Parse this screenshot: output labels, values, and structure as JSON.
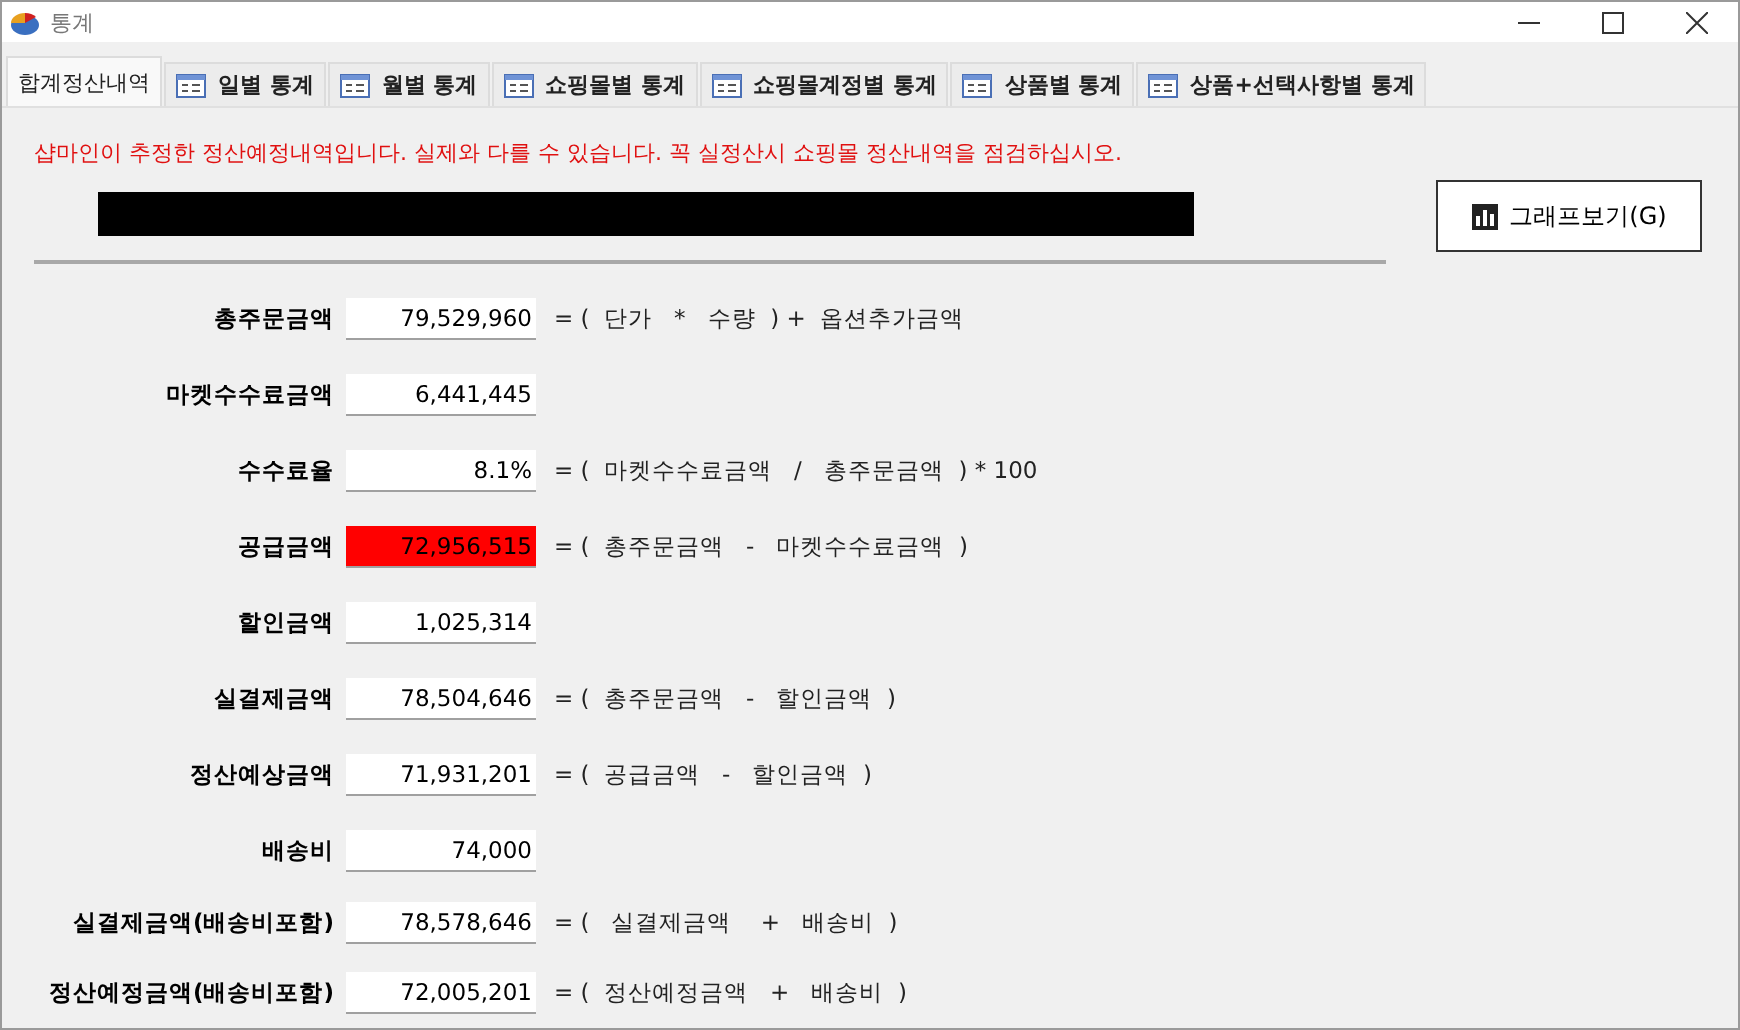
{
  "window": {
    "title": "통계"
  },
  "tabs": [
    {
      "label": "합계정산내역",
      "selected": true,
      "icon": false
    },
    {
      "label": "일별 통계",
      "selected": false,
      "icon": true
    },
    {
      "label": "월별 통계",
      "selected": false,
      "icon": true
    },
    {
      "label": "쇼핑몰별 통계",
      "selected": false,
      "icon": true
    },
    {
      "label": "쇼핑몰계정별 통계",
      "selected": false,
      "icon": true
    },
    {
      "label": "상품별 통계",
      "selected": false,
      "icon": true
    },
    {
      "label": "상품+선택사항별 통계",
      "selected": false,
      "icon": true
    }
  ],
  "notice": "샵마인이 추정한 정산예정내역입니다. 실제와 다를 수 있습니다. 꼭 실정산시 쇼핑몰 정산내역을 점검하십시오.",
  "graph_button": {
    "label": "그래프보기(G)"
  },
  "rows": [
    {
      "label": "총주문금액",
      "value": "79,529,960",
      "highlighted": false,
      "formula": "= (  단가   *   수량  ) +  옵션추가금액"
    },
    {
      "label": "마켓수수료금액",
      "value": "6,441,445",
      "highlighted": false
    },
    {
      "label": "수수료율",
      "value": "8.1%",
      "highlighted": false,
      "formula": "= (  마켓수수료금액   /   총주문금액  ) * 100"
    },
    {
      "label": "공급금액",
      "value": "72,956,515",
      "highlighted": true,
      "formula": "= (  총주문금액   -   마켓수수료금액  )"
    },
    {
      "label": "할인금액",
      "value": "1,025,314",
      "highlighted": false
    },
    {
      "label": "실결제금액",
      "value": "78,504,646",
      "highlighted": false,
      "formula": "= (  총주문금액   -   할인금액  )"
    },
    {
      "label": "정산예상금액",
      "value": "71,931,201",
      "highlighted": false,
      "formula": "= (  공급금액   -   할인금액  )"
    },
    {
      "label": "배송비",
      "value": "74,000",
      "highlighted": false
    },
    {
      "label": "실결제금액(배송비포함)",
      "value": "78,578,646",
      "highlighted": false,
      "formula": "= (   실결제금액    +   배송비  )"
    },
    {
      "label": "정산예정금액(배송비포함)",
      "value": "72,005,201",
      "highlighted": false,
      "formula": "= (  정산예정금액   +   배송비  )"
    }
  ]
}
